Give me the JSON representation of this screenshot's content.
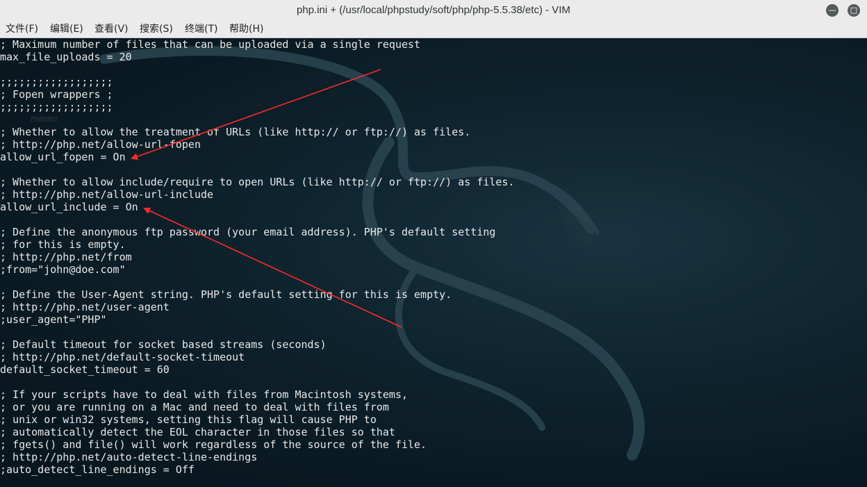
{
  "window": {
    "title": "php.ini + (/usr/local/phpstudy/soft/php/php-5.5.38/etc) - VIM",
    "minimize_glyph": "—",
    "maximize_glyph": "□"
  },
  "menu": {
    "items": [
      {
        "label": "文件(F)"
      },
      {
        "label": "编辑(E)"
      },
      {
        "label": "查看(V)"
      },
      {
        "label": "搜索(S)"
      },
      {
        "label": "终端(T)"
      },
      {
        "label": "帮助(H)"
      }
    ]
  },
  "terminal": {
    "lines": [
      "; Maximum number of files that can be uploaded via a single request",
      "max_file_uploads = 20",
      "",
      ";;;;;;;;;;;;;;;;;;",
      "; Fopen wrappers ;",
      ";;;;;;;;;;;;;;;;;;",
      "",
      "; Whether to allow the treatment of URLs (like http:// or ftp://) as files.",
      "; http://php.net/allow-url-fopen",
      "allow_url_fopen = On",
      "",
      "; Whether to allow include/require to open URLs (like http:// or ftp://) as files.",
      "; http://php.net/allow-url-include",
      "allow_url_include = On",
      "",
      "; Define the anonymous ftp password (your email address). PHP's default setting",
      "; for this is empty.",
      "; http://php.net/from",
      ";from=\"john@doe.com\"",
      "",
      "; Define the User-Agent string. PHP's default setting for this is empty.",
      "; http://php.net/user-agent",
      ";user_agent=\"PHP\"",
      "",
      "; Default timeout for socket based streams (seconds)",
      "; http://php.net/default-socket-timeout",
      "default_socket_timeout = 60",
      "",
      "; If your scripts have to deal with files from Macintosh systems,",
      "; or you are running on a Mac and need to deal with files from",
      "; unix or win32 systems, setting this flag will cause PHP to",
      "; automatically detect the EOL character in those files so that",
      "; fgets() and file() will work regardless of the source of the file.",
      "; http://php.net/auto-detect-line-endings",
      ";auto_detect_line_endings = Off"
    ],
    "desktop_ghost_label": "master"
  },
  "annotations": {
    "arrow_color": "#ff2a2a",
    "arrows": [
      {
        "target": "allow_url_fopen = On"
      },
      {
        "target": "allow_url_include = On"
      }
    ]
  },
  "colors": {
    "titlebar_bg": "#ebebeb",
    "terminal_bg": "#0b1a22",
    "terminal_fg": "#e8e8e8"
  }
}
